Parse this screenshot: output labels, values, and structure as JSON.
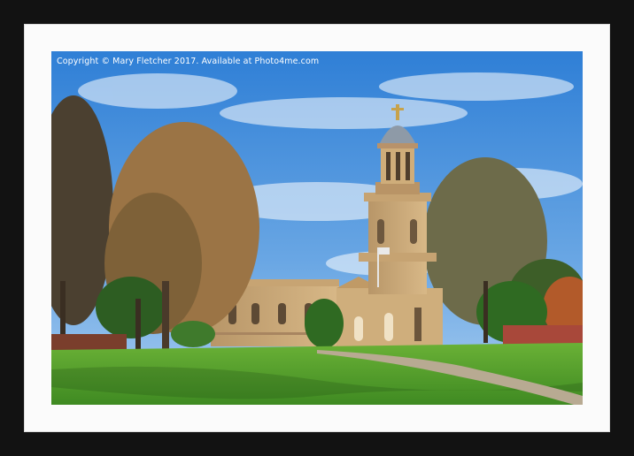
{
  "print": {
    "watermark_text": "Copyright © Mary Fletcher 2017. Available at Photo4me.com",
    "frame_color": "#121212",
    "mount_color": "#fbfbfb"
  },
  "scene": {
    "subject": "church-with-domed-bell-tower",
    "sky_color": "#4a8fd8",
    "grass_color": "#4d9a2a"
  }
}
